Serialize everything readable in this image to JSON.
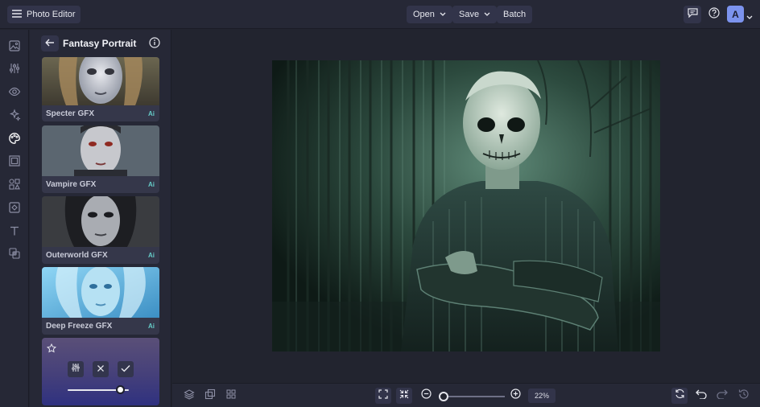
{
  "header": {
    "app_title": "Photo Editor",
    "open_label": "Open",
    "save_label": "Save",
    "batch_label": "Batch",
    "avatar_initial": "A"
  },
  "left_rail": {
    "icons": [
      "image-icon",
      "adjust-icon",
      "eye-icon",
      "effects-icon",
      "artsy-icon",
      "frame-icon",
      "graphics-icon",
      "texture-icon",
      "text-icon",
      "overlay-icon"
    ],
    "active": "artsy-icon"
  },
  "panel": {
    "title": "Fantasy Portrait",
    "effects": [
      {
        "label": "Specter GFX",
        "badge": "Ai"
      },
      {
        "label": "Vampire GFX",
        "badge": "Ai"
      },
      {
        "label": "Outerworld GFX",
        "badge": "Ai"
      },
      {
        "label": "Deep Freeze GFX",
        "badge": "Ai"
      }
    ],
    "settings": {
      "intensity": 0.85
    }
  },
  "bottom": {
    "zoom": "22%"
  },
  "colors": {
    "accent": "#7c93ee",
    "ai_badge": "#65c9c6",
    "background": "#22242f"
  }
}
